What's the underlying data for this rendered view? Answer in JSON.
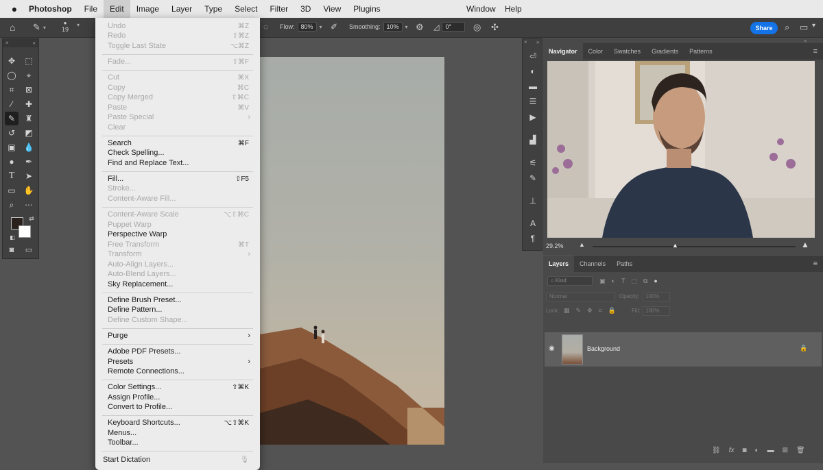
{
  "menubar": {
    "apple": "",
    "app": "Photoshop",
    "items": [
      "File",
      "Edit",
      "Image",
      "Layer",
      "Type",
      "Select",
      "Filter",
      "3D",
      "View",
      "Plugins"
    ],
    "window": "Window",
    "help": "Help"
  },
  "options": {
    "brush_size": "19",
    "flow_label": "Flow:",
    "flow_value": "80%",
    "smoothing_label": "Smoothing:",
    "smoothing_value": "10%",
    "angle_value": "0°",
    "share": "Share"
  },
  "edit_menu": {
    "undo": {
      "label": "Undo",
      "sc": "⌘Z"
    },
    "redo": {
      "label": "Redo",
      "sc": "⇧⌘Z"
    },
    "toggle": {
      "label": "Toggle Last State",
      "sc": "⌥⌘Z"
    },
    "fade": {
      "label": "Fade...",
      "sc": "⇧⌘F"
    },
    "cut": {
      "label": "Cut",
      "sc": "⌘X"
    },
    "copy": {
      "label": "Copy",
      "sc": "⌘C"
    },
    "copy_merged": {
      "label": "Copy Merged",
      "sc": "⇧⌘C"
    },
    "paste": {
      "label": "Paste",
      "sc": "⌘V"
    },
    "paste_special": {
      "label": "Paste Special"
    },
    "clear": {
      "label": "Clear"
    },
    "search": {
      "label": "Search",
      "sc": "⌘F"
    },
    "check_spelling": {
      "label": "Check Spelling..."
    },
    "find_replace": {
      "label": "Find and Replace Text..."
    },
    "fill": {
      "label": "Fill...",
      "sc": "⇧F5"
    },
    "stroke": {
      "label": "Stroke..."
    },
    "content_aware_fill": {
      "label": "Content-Aware Fill..."
    },
    "content_aware_scale": {
      "label": "Content-Aware Scale",
      "sc": "⌥⇧⌘C"
    },
    "puppet_warp": {
      "label": "Puppet Warp"
    },
    "perspective_warp": {
      "label": "Perspective Warp"
    },
    "free_transform": {
      "label": "Free Transform",
      "sc": "⌘T"
    },
    "transform": {
      "label": "Transform"
    },
    "auto_align": {
      "label": "Auto-Align Layers..."
    },
    "auto_blend": {
      "label": "Auto-Blend Layers..."
    },
    "sky_replacement": {
      "label": "Sky Replacement..."
    },
    "define_brush": {
      "label": "Define Brush Preset..."
    },
    "define_pattern": {
      "label": "Define Pattern..."
    },
    "define_shape": {
      "label": "Define Custom Shape..."
    },
    "purge": {
      "label": "Purge"
    },
    "pdf_presets": {
      "label": "Adobe PDF Presets..."
    },
    "presets": {
      "label": "Presets"
    },
    "remote": {
      "label": "Remote Connections..."
    },
    "color_settings": {
      "label": "Color Settings...",
      "sc": "⇧⌘K"
    },
    "assign_profile": {
      "label": "Assign Profile..."
    },
    "convert_profile": {
      "label": "Convert to Profile..."
    },
    "keyboard": {
      "label": "Keyboard Shortcuts...",
      "sc": "⌥⇧⌘K"
    },
    "menus": {
      "label": "Menus..."
    },
    "toolbar": {
      "label": "Toolbar..."
    },
    "dictation": {
      "label": "Start Dictation"
    }
  },
  "navigator": {
    "tabs": [
      "Navigator",
      "Color",
      "Swatches",
      "Gradients",
      "Patterns"
    ],
    "zoom": "29.2%"
  },
  "layers": {
    "tabs": [
      "Layers",
      "Channels",
      "Paths"
    ],
    "kind": "Kind",
    "blend": "Normal",
    "opacity_label": "Opacity:",
    "opacity_value": "100%",
    "lock_label": "Lock:",
    "fill_label": "Fill:",
    "fill_value": "100%",
    "layer_name": "Background"
  },
  "colors": {
    "accent": "#1473e6",
    "menu_bg": "#ececec",
    "panel_bg": "#494949"
  }
}
